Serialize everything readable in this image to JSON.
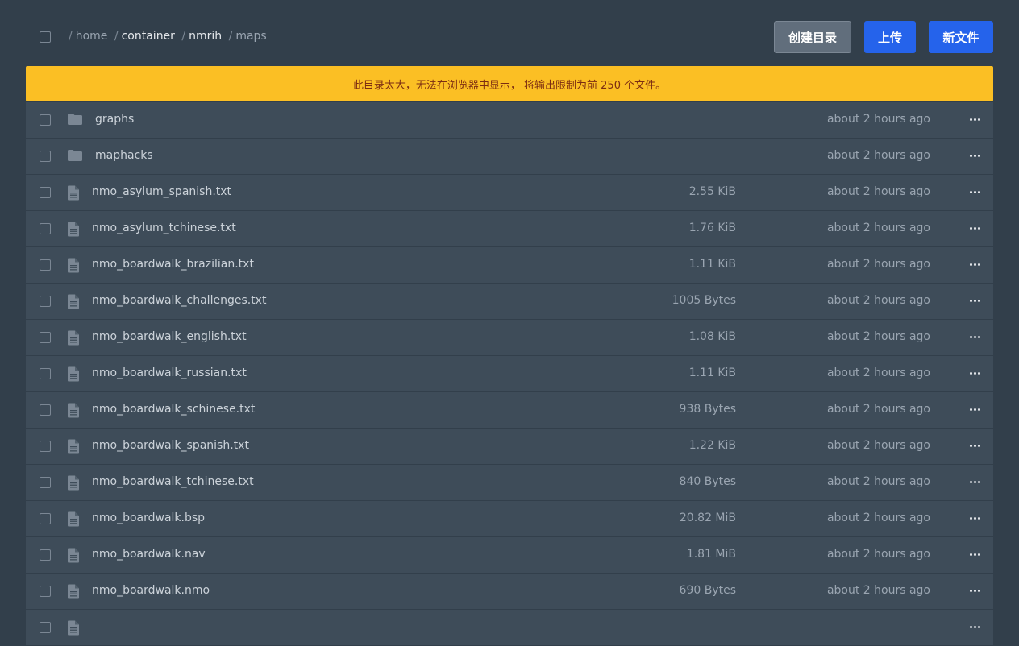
{
  "breadcrumb": {
    "separator": "/",
    "crumbs": [
      "home",
      "container",
      "nmrih",
      "maps"
    ]
  },
  "toolbar": {
    "mkdir_label": "创建目录",
    "upload_label": "上传",
    "newfile_label": "新文件"
  },
  "notice": {
    "text": "此目录太大，无法在浏览器中显示， 将输出限制为前 250 个文件。"
  },
  "colors": {
    "background": "#323f4b",
    "row": "#3e4c59",
    "primary_button": "#2563eb",
    "secondary_button": "#616e7c",
    "notice": "#fbbf24"
  },
  "files": [
    {
      "type": "folder",
      "icon": "folder-icon",
      "name": "graphs",
      "size": "",
      "modified": "about 2 hours ago"
    },
    {
      "type": "folder",
      "icon": "folder-icon",
      "name": "maphacks",
      "size": "",
      "modified": "about 2 hours ago"
    },
    {
      "type": "file",
      "icon": "file-icon",
      "name": "nmo_asylum_spanish.txt",
      "size": "2.55 KiB",
      "modified": "about 2 hours ago"
    },
    {
      "type": "file",
      "icon": "file-icon",
      "name": "nmo_asylum_tchinese.txt",
      "size": "1.76 KiB",
      "modified": "about 2 hours ago"
    },
    {
      "type": "file",
      "icon": "file-icon",
      "name": "nmo_boardwalk_brazilian.txt",
      "size": "1.11 KiB",
      "modified": "about 2 hours ago"
    },
    {
      "type": "file",
      "icon": "file-icon",
      "name": "nmo_boardwalk_challenges.txt",
      "size": "1005 Bytes",
      "modified": "about 2 hours ago"
    },
    {
      "type": "file",
      "icon": "file-icon",
      "name": "nmo_boardwalk_english.txt",
      "size": "1.08 KiB",
      "modified": "about 2 hours ago"
    },
    {
      "type": "file",
      "icon": "file-icon",
      "name": "nmo_boardwalk_russian.txt",
      "size": "1.11 KiB",
      "modified": "about 2 hours ago"
    },
    {
      "type": "file",
      "icon": "file-icon",
      "name": "nmo_boardwalk_schinese.txt",
      "size": "938 Bytes",
      "modified": "about 2 hours ago"
    },
    {
      "type": "file",
      "icon": "file-icon",
      "name": "nmo_boardwalk_spanish.txt",
      "size": "1.22 KiB",
      "modified": "about 2 hours ago"
    },
    {
      "type": "file",
      "icon": "file-icon",
      "name": "nmo_boardwalk_tchinese.txt",
      "size": "840 Bytes",
      "modified": "about 2 hours ago"
    },
    {
      "type": "file",
      "icon": "file-icon",
      "name": "nmo_boardwalk.bsp",
      "size": "20.82 MiB",
      "modified": "about 2 hours ago"
    },
    {
      "type": "file",
      "icon": "file-icon",
      "name": "nmo_boardwalk.nav",
      "size": "1.81 MiB",
      "modified": "about 2 hours ago"
    },
    {
      "type": "file",
      "icon": "file-icon",
      "name": "nmo_boardwalk.nmo",
      "size": "690 Bytes",
      "modified": "about 2 hours ago"
    },
    {
      "type": "file",
      "icon": "file-icon",
      "name": "",
      "size": "",
      "modified": ""
    }
  ]
}
